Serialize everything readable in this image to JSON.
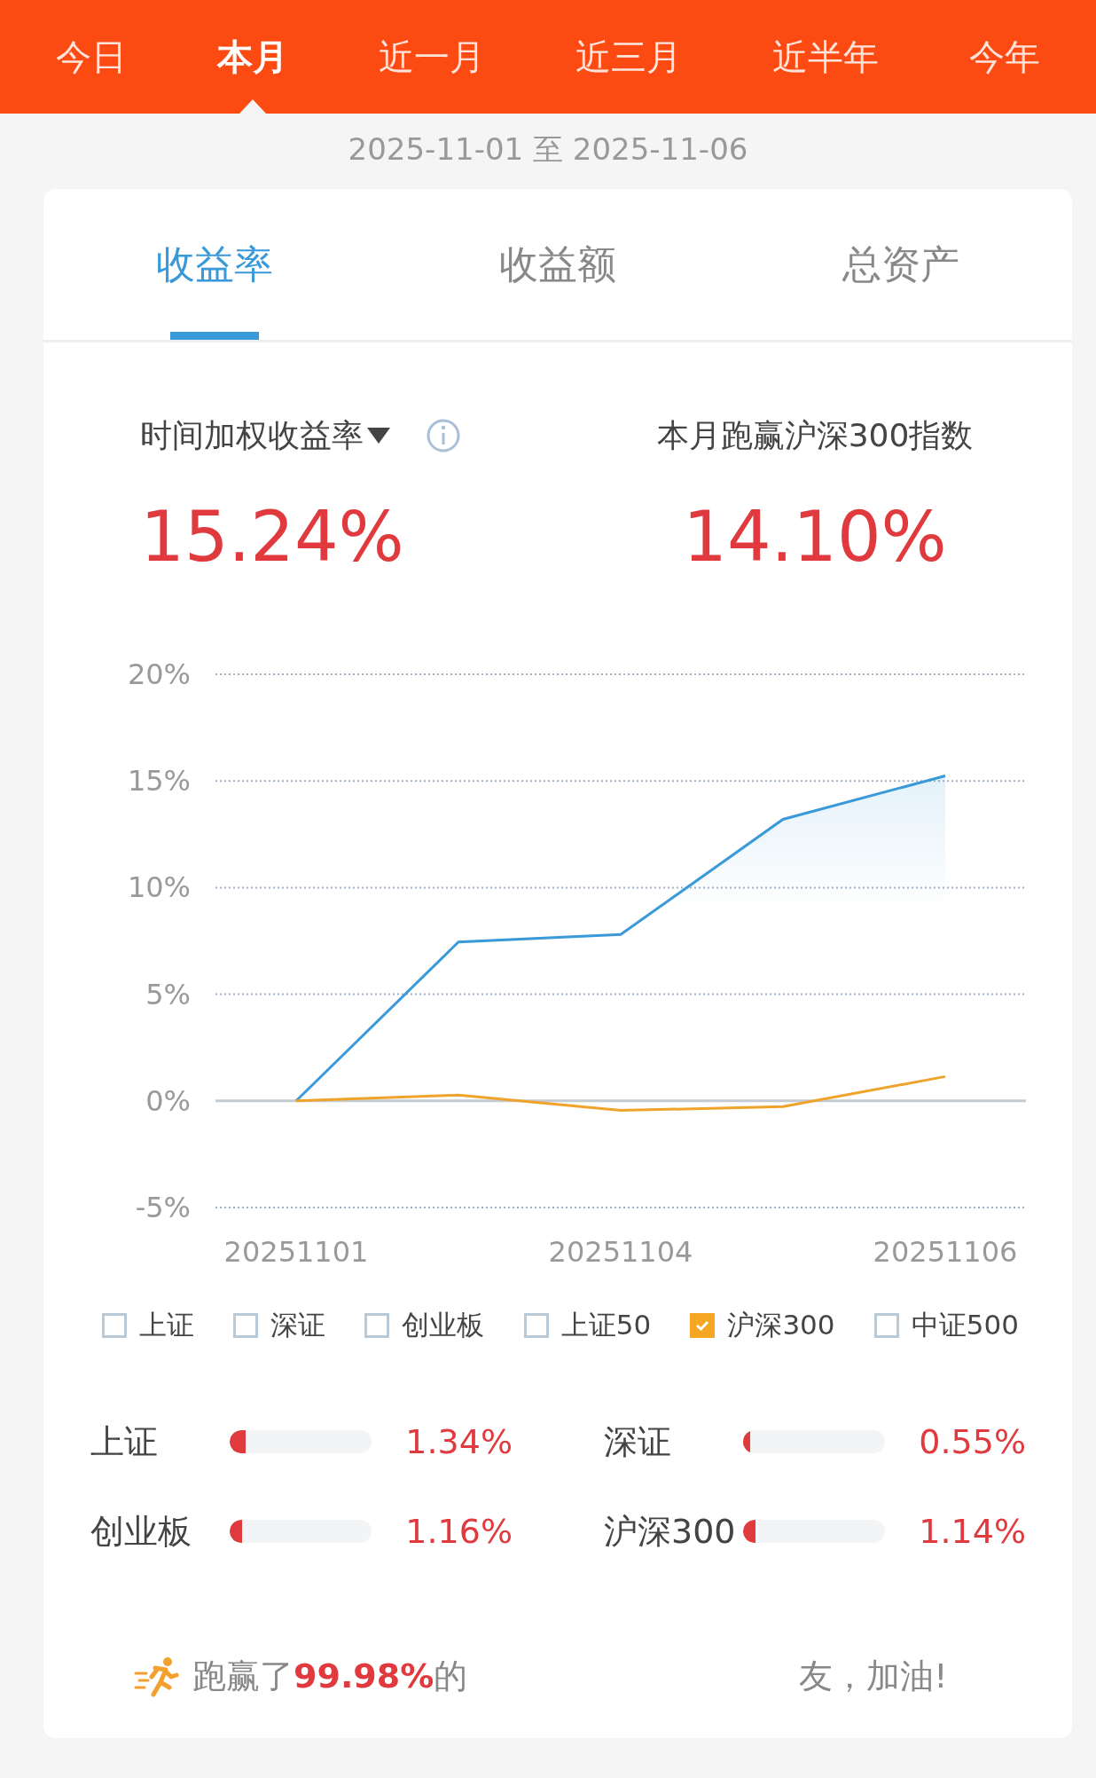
{
  "period_tabs": [
    {
      "label": "今日",
      "selected": false
    },
    {
      "label": "本月",
      "selected": true
    },
    {
      "label": "近一月",
      "selected": false
    },
    {
      "label": "近三月",
      "selected": false
    },
    {
      "label": "近半年",
      "selected": false
    },
    {
      "label": "今年",
      "selected": false
    }
  ],
  "date_range": "2025-11-01 至 2025-11-06",
  "metric_tabs": [
    {
      "label": "收益率",
      "selected": true
    },
    {
      "label": "收益额",
      "selected": false
    },
    {
      "label": "总资产",
      "selected": false
    }
  ],
  "metrics": [
    {
      "kind": "dropdown",
      "label": "时间加权收益率",
      "value": "15.24%"
    },
    {
      "kind": "plain",
      "label": "本月跑赢沪深300指数",
      "value": "14.10%"
    }
  ],
  "chart": {
    "chart_data": {
      "type": "line",
      "ylim": [
        -5,
        20
      ],
      "yticks": [
        {
          "value": 20,
          "label": "20%"
        },
        {
          "value": 15,
          "label": "15%"
        },
        {
          "value": 10,
          "label": "10%"
        },
        {
          "value": 5,
          "label": "5%"
        },
        {
          "value": 0,
          "label": "0%"
        },
        {
          "value": -5,
          "label": "-5%"
        }
      ],
      "categories": [
        "20251101",
        null,
        "20251104",
        null,
        "20251106"
      ],
      "grid": true,
      "series": [
        {
          "color": "#3a9ad9",
          "values": [
            0,
            7.45,
            7.8,
            13.2,
            15.24
          ]
        },
        {
          "color": "#f0a32a",
          "values": [
            0,
            0.27,
            -0.45,
            -0.27,
            1.14
          ]
        }
      ]
    }
  },
  "benchmarks": [
    {
      "label": "上证",
      "checked": false
    },
    {
      "label": "深证",
      "checked": false
    },
    {
      "label": "创业板",
      "checked": false
    },
    {
      "label": "上证50",
      "checked": false
    },
    {
      "label": "沪深300",
      "checked": true
    },
    {
      "label": "中证500",
      "checked": false
    }
  ],
  "index_returns": [
    {
      "name": "上证",
      "level": 0.11,
      "value": "1.34%"
    },
    {
      "name": "深证",
      "level": 0.05,
      "value": "0.55%"
    },
    {
      "name": "创业板",
      "level": 0.09,
      "value": "1.16%"
    },
    {
      "name": "沪深300",
      "level": 0.09,
      "value": "1.14%"
    }
  ],
  "footer": {
    "text_start": "跑赢了**99.98%**的",
    "text_end": "友，加油!"
  }
}
